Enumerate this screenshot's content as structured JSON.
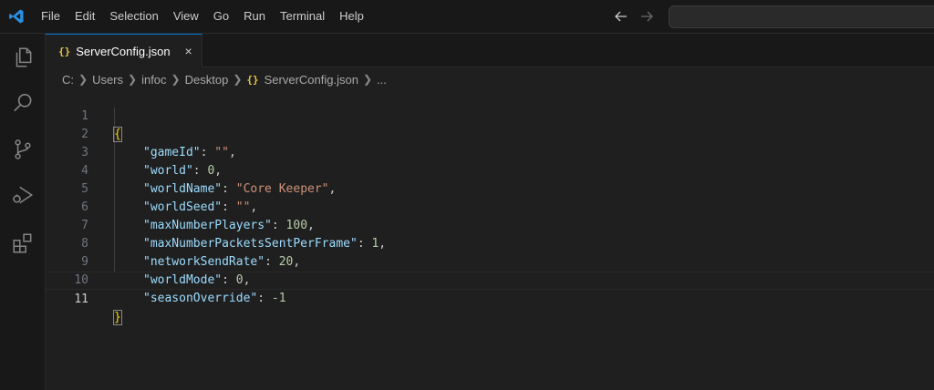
{
  "menu": [
    "File",
    "Edit",
    "Selection",
    "View",
    "Go",
    "Run",
    "Terminal",
    "Help"
  ],
  "tab": {
    "icon": "{}",
    "label": "ServerConfig.json",
    "close": "×"
  },
  "breadcrumb": {
    "parts": [
      "C:",
      "Users",
      "infoc",
      "Desktop"
    ],
    "file_icon": "{}",
    "file": "ServerConfig.json",
    "more": "..."
  },
  "editor": {
    "active_line": 11,
    "lines": [
      {
        "n": "1",
        "open": "{"
      },
      {
        "n": "2",
        "key": "\"gameId\"",
        "sep": ": ",
        "value": "\"\"",
        "vtype": "str",
        "comma": ","
      },
      {
        "n": "3",
        "key": "\"world\"",
        "sep": ": ",
        "value": "0",
        "vtype": "num",
        "comma": ","
      },
      {
        "n": "4",
        "key": "\"worldName\"",
        "sep": ": ",
        "value": "\"Core Keeper\"",
        "vtype": "str",
        "comma": ","
      },
      {
        "n": "5",
        "key": "\"worldSeed\"",
        "sep": ": ",
        "value": "\"\"",
        "vtype": "str",
        "comma": ","
      },
      {
        "n": "6",
        "key": "\"maxNumberPlayers\"",
        "sep": ": ",
        "value": "100",
        "vtype": "num",
        "comma": ","
      },
      {
        "n": "7",
        "key": "\"maxNumberPacketsSentPerFrame\"",
        "sep": ": ",
        "value": "1",
        "vtype": "num",
        "comma": ","
      },
      {
        "n": "8",
        "key": "\"networkSendRate\"",
        "sep": ": ",
        "value": "20",
        "vtype": "num",
        "comma": ","
      },
      {
        "n": "9",
        "key": "\"worldMode\"",
        "sep": ": ",
        "value": "0",
        "vtype": "num",
        "comma": ","
      },
      {
        "n": "10",
        "key": "\"seasonOverride\"",
        "sep": ": ",
        "value": "-1",
        "vtype": "num",
        "comma": ""
      },
      {
        "n": "11",
        "close": "}"
      }
    ]
  },
  "colors": {
    "accent": "#0078d4",
    "json_icon": "#e6c547",
    "key": "#9cdcfe",
    "string": "#ce9178",
    "number": "#b5cea8",
    "bracket": "#ffd700"
  },
  "icons": [
    "vscode-logo-icon",
    "arrow-left-icon",
    "arrow-right-icon",
    "files-icon",
    "search-icon",
    "source-control-icon",
    "run-debug-icon",
    "extensions-icon"
  ]
}
